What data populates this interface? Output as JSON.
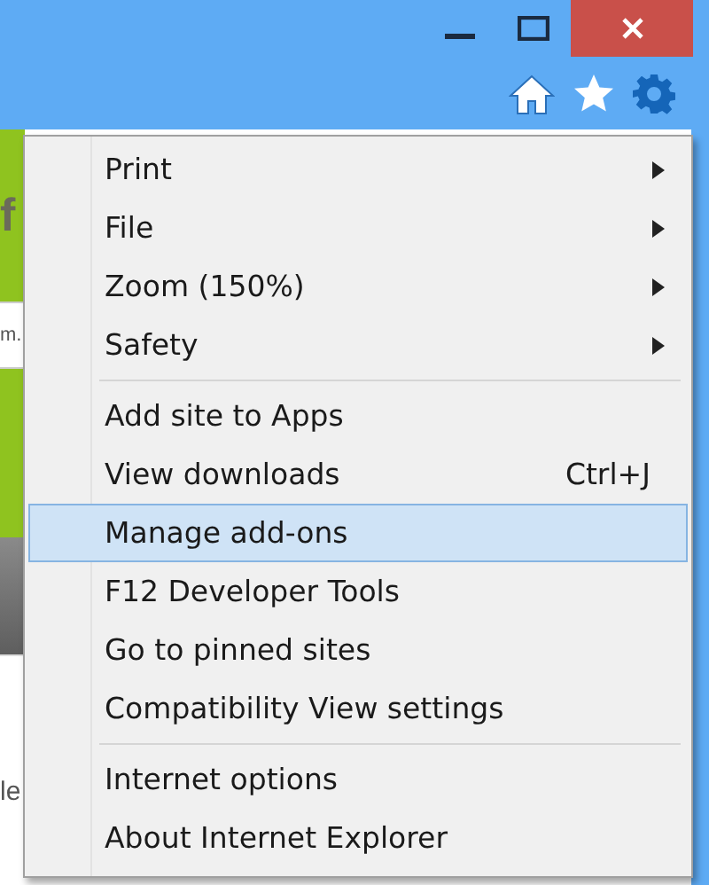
{
  "window": {
    "controls": [
      {
        "kind": "minimize"
      },
      {
        "kind": "maximize"
      },
      {
        "kind": "close"
      }
    ]
  },
  "toolbar": {
    "icons": [
      {
        "kind": "home"
      },
      {
        "kind": "favorites"
      },
      {
        "kind": "settings"
      }
    ]
  },
  "page": {
    "fragments": [
      {
        "kind": "green",
        "text": "f"
      },
      {
        "kind": "field",
        "text": "m."
      },
      {
        "kind": "green"
      },
      {
        "kind": "gray"
      },
      {
        "kind": "white",
        "text": "le"
      }
    ]
  },
  "menu": {
    "groups": [
      [
        {
          "label": "Print",
          "submenu": true,
          "selected": false
        },
        {
          "label": "File",
          "submenu": true,
          "selected": false
        },
        {
          "label": "Zoom (150%)",
          "submenu": true,
          "selected": false
        },
        {
          "label": "Safety",
          "submenu": true,
          "selected": false
        }
      ],
      [
        {
          "label": "Add site to Apps",
          "submenu": false,
          "selected": false
        },
        {
          "label": "View downloads",
          "submenu": false,
          "shortcut": "Ctrl+J",
          "selected": false
        },
        {
          "label": "Manage add-ons",
          "submenu": false,
          "selected": true
        },
        {
          "label": "F12 Developer Tools",
          "submenu": false,
          "selected": false
        },
        {
          "label": "Go to pinned sites",
          "submenu": false,
          "selected": false
        },
        {
          "label": "Compatibility View settings",
          "submenu": false,
          "selected": false
        }
      ],
      [
        {
          "label": "Internet options",
          "submenu": false,
          "selected": false
        },
        {
          "label": "About Internet Explorer",
          "submenu": false,
          "selected": false
        }
      ]
    ]
  }
}
